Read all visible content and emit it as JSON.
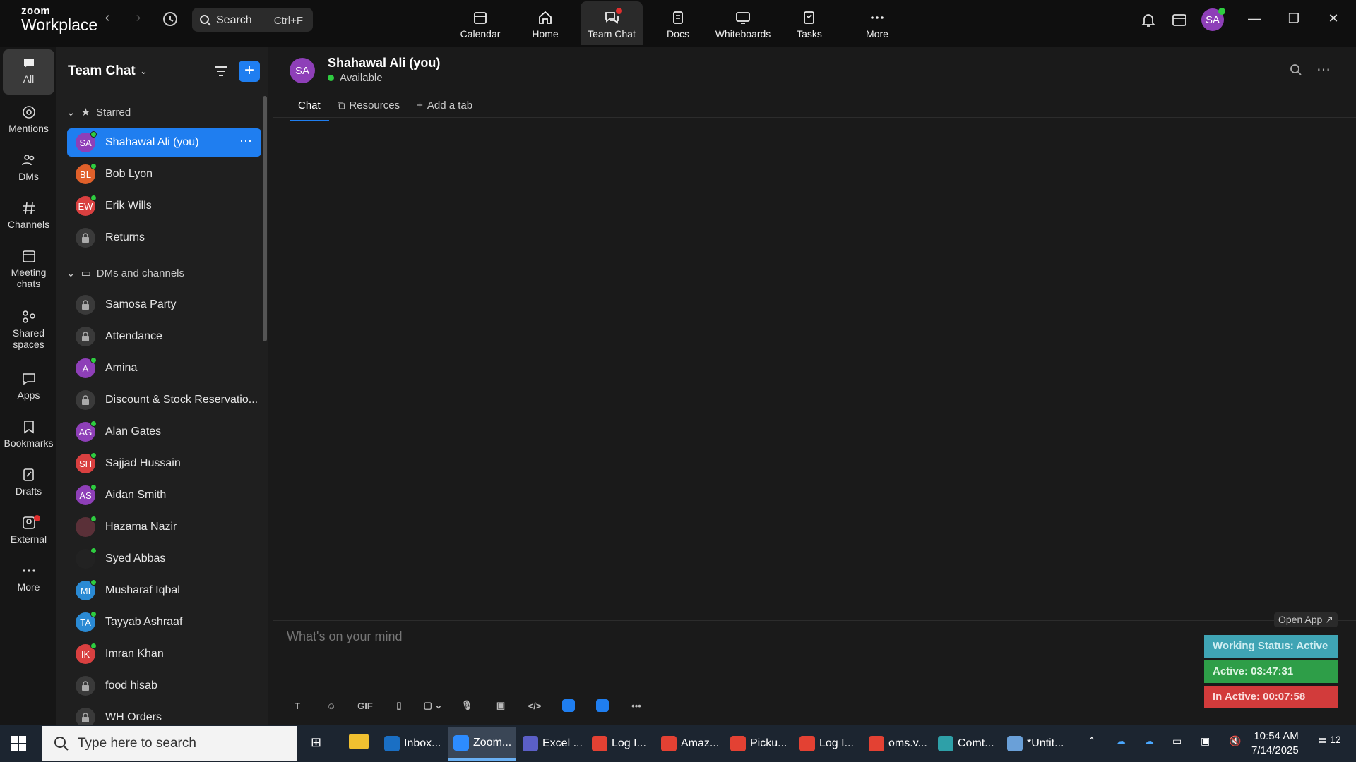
{
  "app": {
    "brand_line1": "zoom",
    "brand_line2": "Workplace"
  },
  "search": {
    "label": "Search",
    "shortcut": "Ctrl+F"
  },
  "topnav": [
    {
      "label": "Calendar"
    },
    {
      "label": "Home"
    },
    {
      "label": "Team Chat"
    },
    {
      "label": "Docs"
    },
    {
      "label": "Whiteboards"
    },
    {
      "label": "Tasks"
    },
    {
      "label": "More"
    }
  ],
  "user": {
    "initials": "SA"
  },
  "rail": [
    {
      "label": "All"
    },
    {
      "label": "Mentions"
    },
    {
      "label": "DMs"
    },
    {
      "label": "Channels"
    },
    {
      "label": "Meeting chats"
    },
    {
      "label": "Shared spaces"
    },
    {
      "label": "Apps"
    },
    {
      "label": "Bookmarks"
    },
    {
      "label": "Drafts"
    },
    {
      "label": "External"
    },
    {
      "label": "More"
    }
  ],
  "sidebar": {
    "title": "Team Chat",
    "starred_header": "Starred",
    "dms_header": "DMs and channels",
    "starred": [
      {
        "label": "Shahawal Ali (you)",
        "initials": "SA",
        "color": "#8e3fb8"
      },
      {
        "label": "Bob Lyon",
        "initials": "BL",
        "color": "#e0602a"
      },
      {
        "label": "Erik Wills",
        "initials": "EW",
        "color": "#d94040"
      },
      {
        "label": "Returns",
        "initials": ""
      }
    ],
    "dms": [
      {
        "label": "Samosa Party",
        "initials": ""
      },
      {
        "label": "Attendance",
        "initials": ""
      },
      {
        "label": "Amina",
        "initials": "A",
        "color": "#8e3fb8"
      },
      {
        "label": "Discount & Stock Reservatio...",
        "initials": ""
      },
      {
        "label": "Alan Gates",
        "initials": "AG",
        "color": "#8e3fb8"
      },
      {
        "label": "Sajjad Hussain",
        "initials": "SH",
        "color": "#d94040"
      },
      {
        "label": "Aidan Smith",
        "initials": "AS",
        "color": "#8e3fb8"
      },
      {
        "label": "Hazama Nazir",
        "initials": "",
        "color": "#5a3038"
      },
      {
        "label": "Syed Abbas",
        "initials": "",
        "color": "#222"
      },
      {
        "label": "Musharaf Iqbal",
        "initials": "MI",
        "color": "#2a8ad4"
      },
      {
        "label": "Tayyab Ashraaf",
        "initials": "TA",
        "color": "#2a8ad4"
      },
      {
        "label": "Imran Khan",
        "initials": "IK",
        "color": "#d94040"
      },
      {
        "label": "food hisab",
        "initials": ""
      },
      {
        "label": "WH Orders",
        "initials": ""
      }
    ]
  },
  "chat": {
    "avatar": "SA",
    "name": "Shahawal Ali (you)",
    "status": "Available",
    "tabs": [
      {
        "label": "Chat"
      },
      {
        "label": "Resources"
      },
      {
        "label": "Add a tab"
      }
    ],
    "composer_placeholder": "What's on your mind"
  },
  "status_panel": {
    "open_app": "Open App ↗",
    "working": "Working Status: Active",
    "active": "Active: 03:47:31",
    "inactive": "In Active: 00:07:58"
  },
  "taskbar": {
    "search_placeholder": "Type here to search",
    "apps": [
      {
        "label": "Inbox..."
      },
      {
        "label": "Zoom..."
      },
      {
        "label": "Excel ..."
      },
      {
        "label": "Log I..."
      },
      {
        "label": "Amaz..."
      },
      {
        "label": "Picku..."
      },
      {
        "label": "Log I..."
      },
      {
        "label": "oms.v..."
      },
      {
        "label": "Comt..."
      },
      {
        "label": "*Untit..."
      }
    ],
    "time": "10:54 AM",
    "date": "7/14/2025",
    "notifications": "12"
  }
}
